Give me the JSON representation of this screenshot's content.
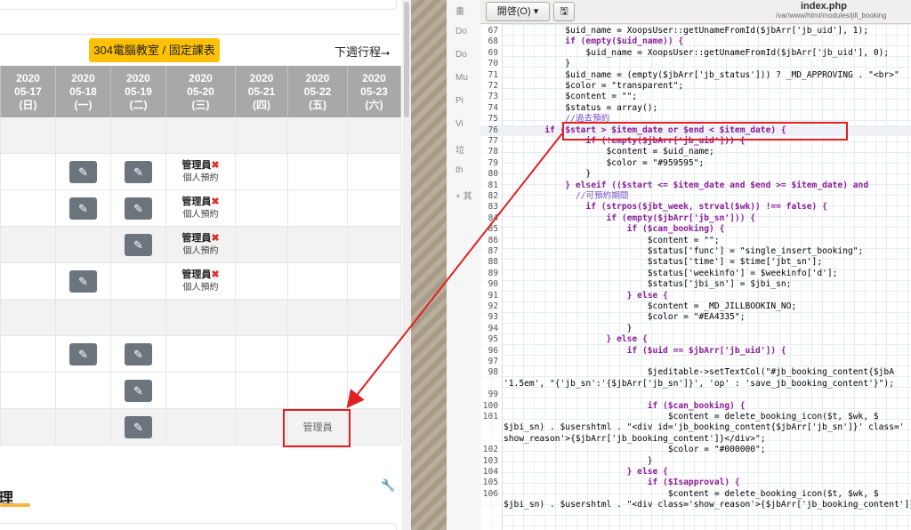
{
  "left_panel": {
    "classroom_button": "304電腦教室 / 固定課表",
    "next_week": "下週行程⭢",
    "days": [
      {
        "year": "2020",
        "date": "05-17",
        "wd": "(日)"
      },
      {
        "year": "2020",
        "date": "05-18",
        "wd": "(一)"
      },
      {
        "year": "2020",
        "date": "05-19",
        "wd": "(二)"
      },
      {
        "year": "2020",
        "date": "05-20",
        "wd": "(三)"
      },
      {
        "year": "2020",
        "date": "05-21",
        "wd": "(四)"
      },
      {
        "year": "2020",
        "date": "05-22",
        "wd": "(五)"
      },
      {
        "year": "2020",
        "date": "05-23",
        "wd": "(六)"
      }
    ],
    "booking_user": "管理員",
    "booking_x": "✖",
    "booking_type": "個人預約",
    "admin_plain": "管理員",
    "section_title": "理"
  },
  "sidebar": {
    "items": [
      "畫",
      "Do",
      "Do",
      "Mu",
      "Pi",
      "Vi",
      "垃",
      "th",
      "+ 其"
    ]
  },
  "editor": {
    "open_button": "開啓(O) ▾",
    "file_title": "index.php",
    "file_path": "/var/www/html/modules/jill_booking",
    "lines": [
      {
        "n": "67",
        "code": "            $uid_name = XoopsUser::getUnameFromId($jbArr['jb_uid'], 1);"
      },
      {
        "n": "68",
        "code": "            if (empty($uid_name)) {"
      },
      {
        "n": "69",
        "code": "                $uid_name = XoopsUser::getUnameFromId($jbArr['jb_uid'], 0);"
      },
      {
        "n": "70",
        "code": "            }"
      },
      {
        "n": "71",
        "code": "            $uid_name = (empty($jbArr['jb_status'])) ? _MD_APPROVING . \"<br>\""
      },
      {
        "n": "72",
        "code": "            $color = \"transparent\";"
      },
      {
        "n": "73",
        "code": "            $content = \"\";"
      },
      {
        "n": "74",
        "code": "            $status = array();"
      },
      {
        "n": "75",
        "code": "            //過去預約"
      },
      {
        "n": "76",
        "code": "        if ($start > $item_date or $end < $item_date) {"
      },
      {
        "n": "77",
        "code": "                if (!empty($jbArr['jb_uid'])) {"
      },
      {
        "n": "78",
        "code": "                    $content = $uid_name;"
      },
      {
        "n": "79",
        "code": "                    $color = \"#959595\";"
      },
      {
        "n": "80",
        "code": "                }"
      },
      {
        "n": "81",
        "code": "            } elseif (($start <= $item_date and $end >= $item_date) and"
      },
      {
        "n": "82",
        "code": "              //可預約期間"
      },
      {
        "n": "83",
        "code": "                if (strpos($jbt_week, strval($wk)) !== false) {"
      },
      {
        "n": "84",
        "code": "                    if (empty($jbArr['jb_sn'])) {"
      },
      {
        "n": "85",
        "code": "                        if ($can_booking) {"
      },
      {
        "n": "86",
        "code": "                            $content = \"\";"
      },
      {
        "n": "87",
        "code": "                            $status['func'] = \"single_insert_booking\";"
      },
      {
        "n": "88",
        "code": "                            $status['time'] = $time['jbt_sn'];"
      },
      {
        "n": "89",
        "code": "                            $status['weekinfo'] = $weekinfo['d'];"
      },
      {
        "n": "90",
        "code": "                            $status['jbi_sn'] = $jbi_sn;"
      },
      {
        "n": "91",
        "code": "                        } else {"
      },
      {
        "n": "92",
        "code": "                            $content = _MD_JILLBOOKIN_NO;"
      },
      {
        "n": "93",
        "code": "                            $color = \"#EA4335\";"
      },
      {
        "n": "94",
        "code": "                        }"
      },
      {
        "n": "95",
        "code": "                    } else {"
      },
      {
        "n": "96",
        "code": "                        if ($uid == $jbArr['jb_uid']) {"
      },
      {
        "n": "97",
        "code": ""
      },
      {
        "n": "98",
        "code": "                            $jeditable->setTextCol(\"#jb_booking_content{$jbA"
      },
      {
        "n": "",
        "code": "'1.5em', \"{'jb_sn':'{$jbArr['jb_sn']}', 'op' : 'save_jb_booking_content'}\");"
      },
      {
        "n": "99",
        "code": ""
      },
      {
        "n": "100",
        "code": "                            if ($can_booking) {"
      },
      {
        "n": "101",
        "code": "                                $content = delete_booking_icon($t, $wk, $"
      },
      {
        "n": "",
        "code": "$jbi_sn) . $usershtml . \"<div id='jb_booking_content{$jbArr['jb_sn']}' class='"
      },
      {
        "n": "",
        "code": "show_reason'>{$jbArr['jb_booking_content']}</div>\";"
      },
      {
        "n": "102",
        "code": "                                $color = \"#000000\";"
      },
      {
        "n": "103",
        "code": "                            }"
      },
      {
        "n": "104",
        "code": "                        } else {"
      },
      {
        "n": "105",
        "code": "                            if ($Isapproval) {"
      },
      {
        "n": "106",
        "code": "                                $content = delete_booking_icon($t, $wk, $"
      },
      {
        "n": "",
        "code": "$jbi_sn) . $usershtml . \"<div class='show_reason'>{$jbArr['jb_booking_content']}</div>\";"
      }
    ]
  },
  "colors": {
    "accent_yellow": "#ffc107",
    "header_gray": "#a8a8a8",
    "edit_button": "#6c757d",
    "annotation_red": "#e02020"
  }
}
